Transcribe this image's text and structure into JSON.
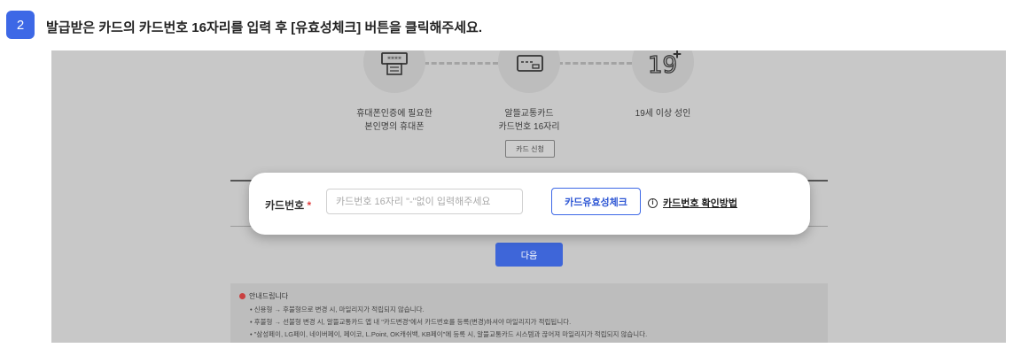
{
  "step": {
    "number": "2",
    "instruction": "발급받은 카드의 카드번호 16자리를 입력 후 [유효성체크] 버튼을 클릭해주세요."
  },
  "requirements": [
    {
      "icon": "phone-keypad-icon",
      "caption_line1": "휴대폰인증에 필요한",
      "caption_line2": "본인명의 휴대폰"
    },
    {
      "icon": "credit-card-icon",
      "caption_line1": "알뜰교통카드",
      "caption_line2": "카드번호 16자리"
    },
    {
      "icon": "age-19-plus-icon",
      "caption_line1": "19세 이상 성인",
      "caption_line2": ""
    }
  ],
  "card_apply_label": "카드 신청",
  "form": {
    "label": "카드번호",
    "required_mark": "*",
    "placeholder": "카드번호 16자리 \"-\"없이 입력해주세요",
    "check_button": "카드유효성체크",
    "help_link": "카드번호 확인방법"
  },
  "next_label": "다음",
  "notice": {
    "title": "안내드립니다",
    "lines": [
      "• 신용형 → 후불형으로 변경 시, 마일리지가 적립되지 않습니다.",
      "• 후불형 → 선불형 변경 시, 알뜰교통카드 앱 내 \"카드변경\"에서 카드번호를 등록(변경)하셔야 마일리지가 적립됩니다.",
      "• \"삼성페이, LG페이, 네이버페이, 페이코, L.Point, OK캐쉬백, KB페이\"에 등록 시, 알뜰교통카드 시스템과 끊어져 마일리지가 적립되지 않습니다."
    ]
  },
  "colors": {
    "accent": "#3d68e6",
    "required": "#e04040",
    "backdrop": "#c8c8c8"
  }
}
